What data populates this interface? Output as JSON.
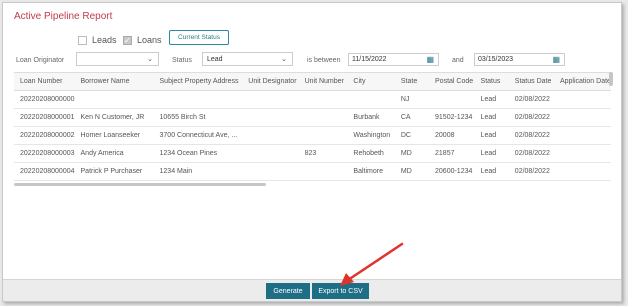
{
  "title": "Active Pipeline Report",
  "filters": {
    "leads_label": "Leads",
    "leads_checked": false,
    "loans_label": "Loans",
    "loans_checked": true,
    "current_status_button": "Current Status",
    "loan_originator_label": "Loan Originator",
    "loan_originator_value": "",
    "status_label": "Status",
    "status_value": "Lead",
    "between_label": "is between",
    "date_from": "11/15/2022",
    "and_label": "and",
    "date_to": "03/15/2023"
  },
  "table": {
    "columns": [
      "Loan Number",
      "Borrower Name",
      "Subject Property Address",
      "Unit Designator",
      "Unit Number",
      "City",
      "State",
      "Postal Code",
      "Status",
      "Status Date",
      "Application Date"
    ],
    "rows": [
      [
        "20220208000000",
        "",
        "",
        "",
        "",
        "",
        "NJ",
        "",
        "Lead",
        "02/08/2022",
        ""
      ],
      [
        "20220208000001",
        "Ken N Customer, JR",
        "10655 Birch St",
        "",
        "",
        "Burbank",
        "CA",
        "91502-1234",
        "Lead",
        "02/08/2022",
        ""
      ],
      [
        "20220208000002",
        "Homer Loanseeker",
        "3700 Connecticut Ave, ...",
        "",
        "",
        "Washington",
        "DC",
        "20008",
        "Lead",
        "02/08/2022",
        ""
      ],
      [
        "20220208000003",
        "Andy America",
        "1234 Ocean Pines",
        "",
        "823",
        "Rehobeth",
        "MD",
        "21857",
        "Lead",
        "02/08/2022",
        ""
      ],
      [
        "20220208000004",
        "Patrick P Purchaser",
        "1234 Main",
        "",
        "",
        "Baltimore",
        "MD",
        "20600-1234",
        "Lead",
        "02/08/2022",
        ""
      ]
    ]
  },
  "footer": {
    "generate_label": "Generate",
    "export_label": "Export to CSV"
  },
  "colors": {
    "title": "#c23b4a",
    "button": "#1e6f86",
    "annotation_arrow": "#e0342b"
  }
}
